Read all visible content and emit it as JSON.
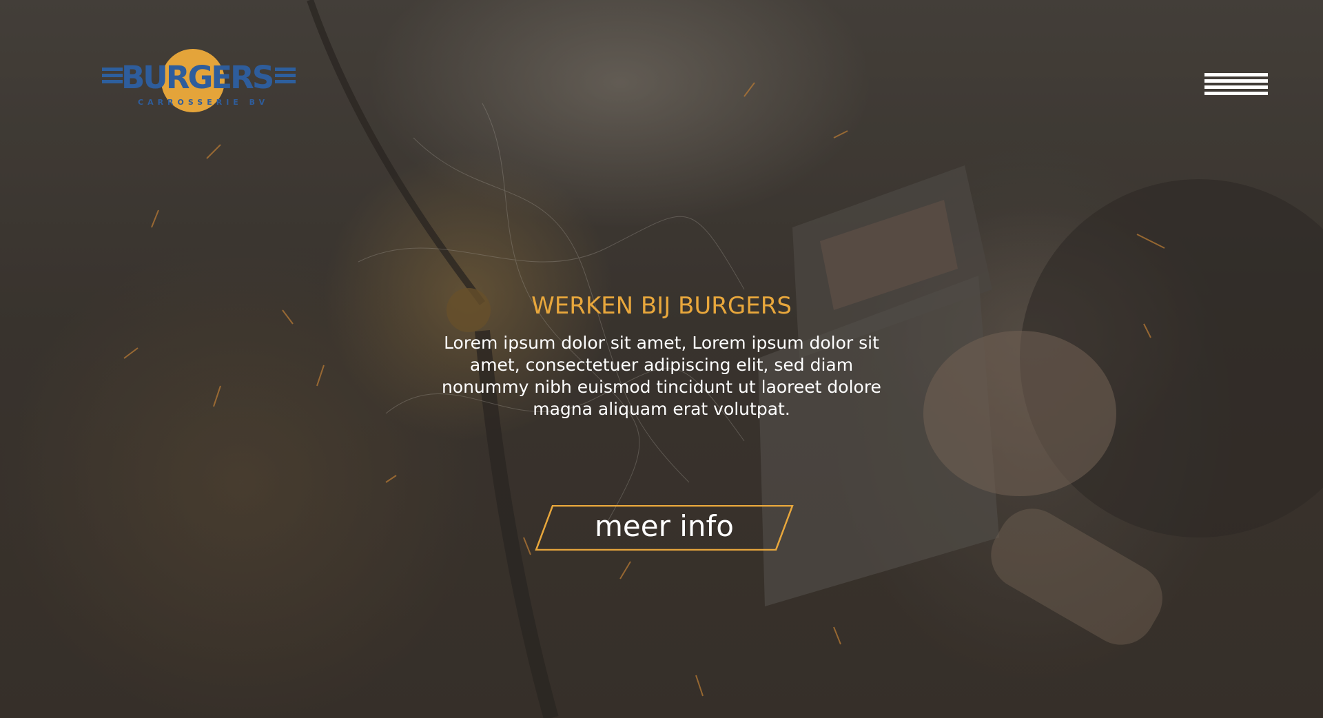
{
  "header": {
    "logo": {
      "wordmark": "BURGERS",
      "subtitle": "CARROSSERIE BV",
      "icon": "burgers-logo"
    },
    "menu_icon": "hamburger-menu-icon"
  },
  "hero": {
    "title": "WERKEN BIJ BURGERS",
    "text": "Lorem ipsum dolor sit amet, Lorem ipsum dolor sit amet, consectetuer adipiscing elit, sed diam nonummy nibh euismod tincidunt ut laoreet dolore magna aliquam erat volutpat.",
    "cta_label": "meer info"
  },
  "colors": {
    "accent": "#e8a73c",
    "logo_blue": "#2e5d9c",
    "text": "#ffffff"
  }
}
